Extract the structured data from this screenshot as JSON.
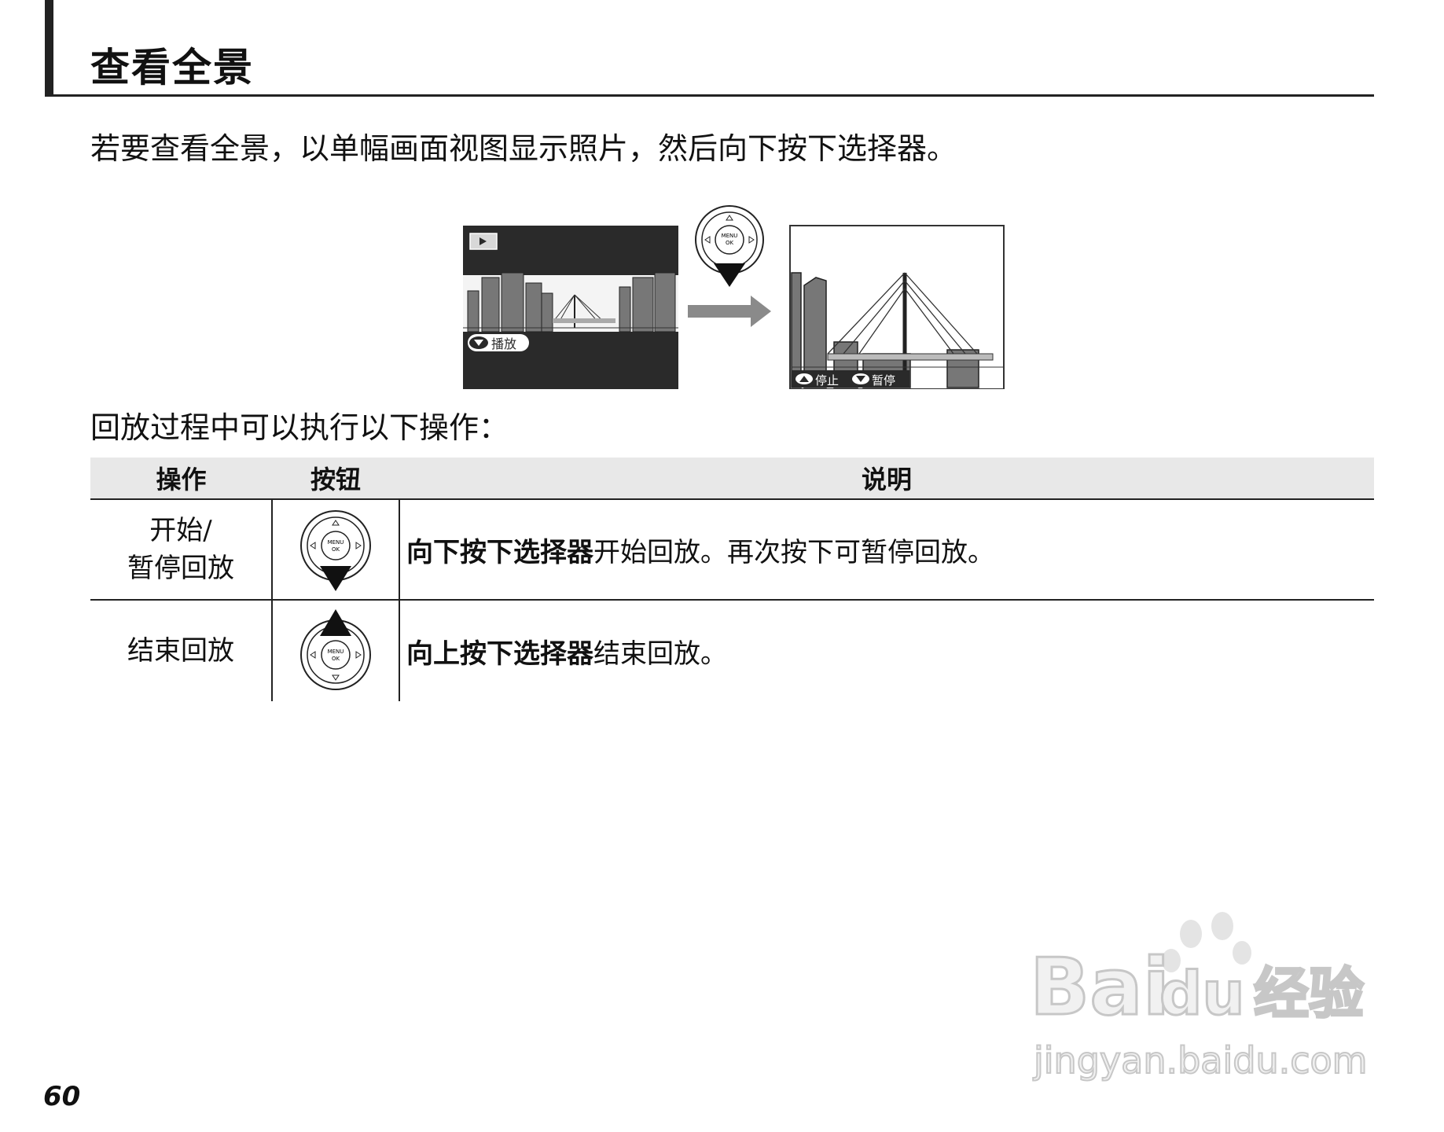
{
  "page": {
    "title": "查看全景",
    "intro": "若要查看全景，以单幅画面视图显示照片，然后向下按下选择器。",
    "subheading": "回放过程中可以执行以下操作：",
    "page_number": "60"
  },
  "figure": {
    "left_screen_label": "播放",
    "right_screen_stop_label": "停止",
    "right_screen_pause_label": "暂停",
    "dial_text_top": "MENU",
    "dial_text_bottom": "OK",
    "colors": {
      "screen_dark": "#2a2a2a",
      "arrow_gray": "#8a8a8a"
    }
  },
  "table": {
    "headers": [
      "操作",
      "按钮",
      "说明"
    ],
    "rows": [
      {
        "op_line1": "开始/",
        "op_line2": "暂停回放",
        "button_icon": "dial-down-arrow-icon",
        "desc_bold": "向下按下选择器",
        "desc_rest": "开始回放。再次按下可暂停回放。"
      },
      {
        "op_line1": "结束回放",
        "op_line2": "",
        "button_icon": "dial-up-arrow-icon",
        "desc_bold": "向上按下选择器",
        "desc_rest": "结束回放。"
      }
    ]
  },
  "watermark": {
    "brand": "Bai",
    "brand2": "du",
    "cn": "经验",
    "url": "jingyan.baidu.com"
  }
}
